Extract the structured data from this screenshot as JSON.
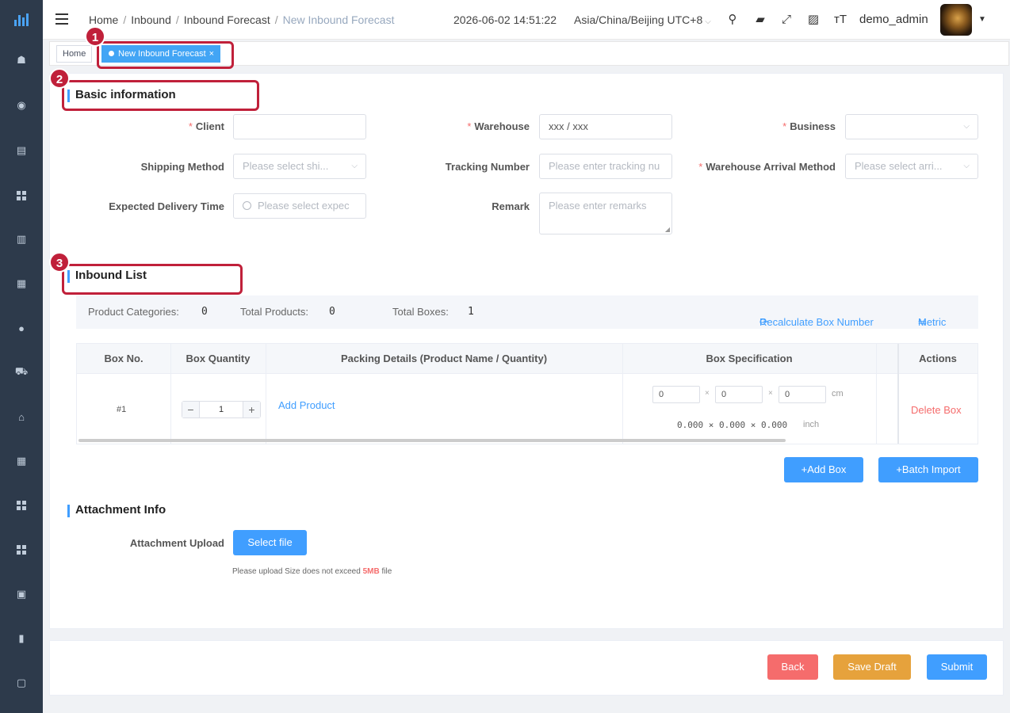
{
  "header": {
    "breadcrumb": [
      "Home",
      "Inbound",
      "Inbound Forecast",
      "New Inbound Forecast"
    ],
    "datetime": "2026-06-02 14:51:22",
    "timezone": "Asia/China/Beijing UTC+8",
    "username": "demo_admin"
  },
  "tags": {
    "home": "Home",
    "active": "New Inbound Forecast",
    "close": "×"
  },
  "annotations": [
    "1",
    "2",
    "3"
  ],
  "basic": {
    "title": "Basic information",
    "client_label": "Client",
    "warehouse_label": "Warehouse",
    "warehouse_value": "xxx / xxx",
    "business_label": "Business",
    "shipping_label": "Shipping Method",
    "shipping_ph": "Please select shi...",
    "tracking_label": "Tracking Number",
    "tracking_ph": "Please enter tracking nu",
    "arrival_label": "Warehouse Arrival Method",
    "arrival_ph": "Please select arri...",
    "delivery_label": "Expected Delivery Time",
    "delivery_ph": "Please select expec",
    "remark_label": "Remark",
    "remark_ph": "Please enter remarks",
    "required_mark": "*"
  },
  "inbound": {
    "title": "Inbound List",
    "product_categories_label": "Product Categories:",
    "product_categories": "0",
    "total_products_label": "Total Products:",
    "total_products": "0",
    "total_boxes_label": "Total Boxes:",
    "total_boxes": "1",
    "recalc": "Recalculate Box Number",
    "metric": "Metric",
    "columns": [
      "Box No.",
      "Box Quantity",
      "Packing Details (Product Name / Quantity)",
      "Box Specification",
      "Actions"
    ],
    "row": {
      "box_no": "#1",
      "qty": "1",
      "add_product": "Add Product",
      "l": "0",
      "w": "0",
      "h": "0",
      "unit_cm": "cm",
      "inch_dims": "0.000 × 0.000 × 0.000",
      "unit_inch": "inch",
      "delete": "Delete Box"
    },
    "add_box": "+Add Box",
    "batch_import": "+Batch Import"
  },
  "attachment": {
    "title": "Attachment Info",
    "upload_label": "Attachment Upload",
    "select_file": "Select file",
    "note_pre": "Please upload Size does not exceed",
    "note_size": "5MB",
    "note_post": "file"
  },
  "footer": {
    "back": "Back",
    "save_draft": "Save Draft",
    "submit": "Submit"
  },
  "colors": {
    "sidebar": "#2d3a4b",
    "primary": "#409eff",
    "danger": "#f56c6c",
    "warning": "#e6a23c",
    "annotation": "#c0203a"
  }
}
